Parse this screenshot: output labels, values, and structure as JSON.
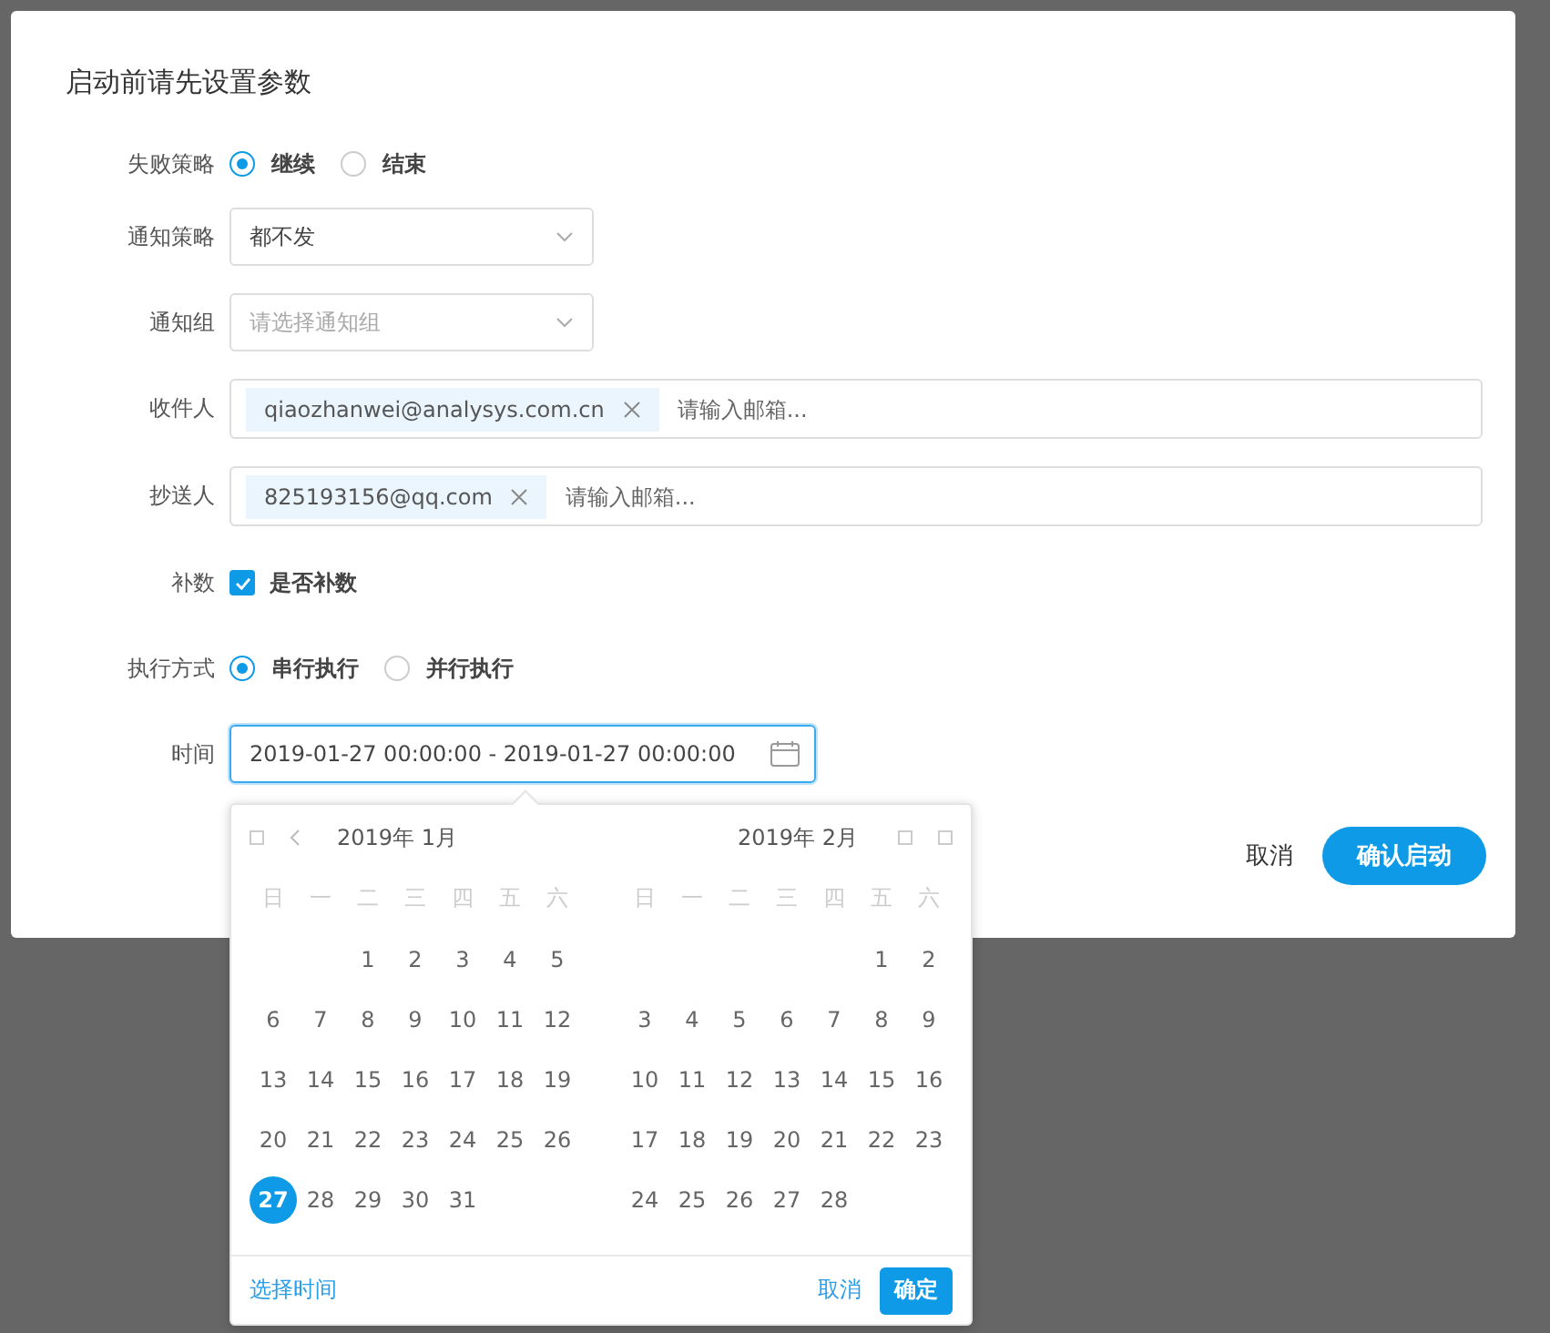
{
  "dialog": {
    "title": "启动前请先设置参数",
    "failure_policy": {
      "label": "失败策略",
      "options": [
        {
          "label": "继续",
          "selected": true
        },
        {
          "label": "结束",
          "selected": false
        }
      ]
    },
    "notify_policy": {
      "label": "通知策略",
      "value": "都不发"
    },
    "notify_group": {
      "label": "通知组",
      "placeholder": "请选择通知组"
    },
    "recipients": {
      "label": "收件人",
      "tags": [
        "qiaozhanwei@analysys.com.cn"
      ],
      "placeholder": "请输入邮箱..."
    },
    "cc": {
      "label": "抄送人",
      "tags": [
        "825193156@qq.com"
      ],
      "placeholder": "请输入邮箱..."
    },
    "backfill": {
      "label": "补数",
      "option": "是否补数",
      "checked": true
    },
    "execution_mode": {
      "label": "执行方式",
      "options": [
        {
          "label": "串行执行",
          "selected": true
        },
        {
          "label": "并行执行",
          "selected": false
        }
      ]
    },
    "time": {
      "label": "时间",
      "value": "2019-01-27 00:00:00 - 2019-01-27 00:00:00"
    },
    "buttons": {
      "cancel": "取消",
      "confirm": "确认启动"
    }
  },
  "date_picker": {
    "months": [
      {
        "title": "2019年 1月",
        "weekdays": [
          "日",
          "一",
          "二",
          "三",
          "四",
          "五",
          "六"
        ],
        "cells": [
          {
            "kind": "blank"
          },
          {
            "kind": "blank"
          },
          {
            "kind": "day",
            "d": "1",
            "selected": false
          },
          {
            "kind": "day",
            "d": "2",
            "selected": false
          },
          {
            "kind": "day",
            "d": "3",
            "selected": false
          },
          {
            "kind": "day",
            "d": "4",
            "selected": false
          },
          {
            "kind": "day",
            "d": "5",
            "selected": false
          },
          {
            "kind": "day",
            "d": "6",
            "selected": false
          },
          {
            "kind": "day",
            "d": "7",
            "selected": false
          },
          {
            "kind": "day",
            "d": "8",
            "selected": false
          },
          {
            "kind": "day",
            "d": "9",
            "selected": false
          },
          {
            "kind": "day",
            "d": "10",
            "selected": false
          },
          {
            "kind": "day",
            "d": "11",
            "selected": false
          },
          {
            "kind": "day",
            "d": "12",
            "selected": false
          },
          {
            "kind": "day",
            "d": "13",
            "selected": false
          },
          {
            "kind": "day",
            "d": "14",
            "selected": false
          },
          {
            "kind": "day",
            "d": "15",
            "selected": false
          },
          {
            "kind": "day",
            "d": "16",
            "selected": false
          },
          {
            "kind": "day",
            "d": "17",
            "selected": false
          },
          {
            "kind": "day",
            "d": "18",
            "selected": false
          },
          {
            "kind": "day",
            "d": "19",
            "selected": false
          },
          {
            "kind": "day",
            "d": "20",
            "selected": false
          },
          {
            "kind": "day",
            "d": "21",
            "selected": false
          },
          {
            "kind": "day",
            "d": "22",
            "selected": false
          },
          {
            "kind": "day",
            "d": "23",
            "selected": false
          },
          {
            "kind": "day",
            "d": "24",
            "selected": false
          },
          {
            "kind": "day",
            "d": "25",
            "selected": false
          },
          {
            "kind": "day",
            "d": "26",
            "selected": false
          },
          {
            "kind": "day",
            "d": "27",
            "selected": true
          },
          {
            "kind": "day",
            "d": "28",
            "selected": false
          },
          {
            "kind": "day",
            "d": "29",
            "selected": false
          },
          {
            "kind": "day",
            "d": "30",
            "selected": false
          },
          {
            "kind": "day",
            "d": "31",
            "selected": false
          }
        ]
      },
      {
        "title": "2019年 2月",
        "weekdays": [
          "日",
          "一",
          "二",
          "三",
          "四",
          "五",
          "六"
        ],
        "cells": [
          {
            "kind": "blank"
          },
          {
            "kind": "blank"
          },
          {
            "kind": "blank"
          },
          {
            "kind": "blank"
          },
          {
            "kind": "blank"
          },
          {
            "kind": "day",
            "d": "1",
            "selected": false
          },
          {
            "kind": "day",
            "d": "2",
            "selected": false
          },
          {
            "kind": "day",
            "d": "3",
            "selected": false
          },
          {
            "kind": "day",
            "d": "4",
            "selected": false
          },
          {
            "kind": "day",
            "d": "5",
            "selected": false
          },
          {
            "kind": "day",
            "d": "6",
            "selected": false
          },
          {
            "kind": "day",
            "d": "7",
            "selected": false
          },
          {
            "kind": "day",
            "d": "8",
            "selected": false
          },
          {
            "kind": "day",
            "d": "9",
            "selected": false
          },
          {
            "kind": "day",
            "d": "10",
            "selected": false
          },
          {
            "kind": "day",
            "d": "11",
            "selected": false
          },
          {
            "kind": "day",
            "d": "12",
            "selected": false
          },
          {
            "kind": "day",
            "d": "13",
            "selected": false
          },
          {
            "kind": "day",
            "d": "14",
            "selected": false
          },
          {
            "kind": "day",
            "d": "15",
            "selected": false
          },
          {
            "kind": "day",
            "d": "16",
            "selected": false
          },
          {
            "kind": "day",
            "d": "17",
            "selected": false
          },
          {
            "kind": "day",
            "d": "18",
            "selected": false
          },
          {
            "kind": "day",
            "d": "19",
            "selected": false
          },
          {
            "kind": "day",
            "d": "20",
            "selected": false
          },
          {
            "kind": "day",
            "d": "21",
            "selected": false
          },
          {
            "kind": "day",
            "d": "22",
            "selected": false
          },
          {
            "kind": "day",
            "d": "23",
            "selected": false
          },
          {
            "kind": "day",
            "d": "24",
            "selected": false
          },
          {
            "kind": "day",
            "d": "25",
            "selected": false
          },
          {
            "kind": "day",
            "d": "26",
            "selected": false
          },
          {
            "kind": "day",
            "d": "27",
            "selected": false
          },
          {
            "kind": "day",
            "d": "28",
            "selected": false
          }
        ]
      }
    ],
    "footer": {
      "select_time": "选择时间",
      "cancel": "取消",
      "ok": "确定"
    }
  }
}
